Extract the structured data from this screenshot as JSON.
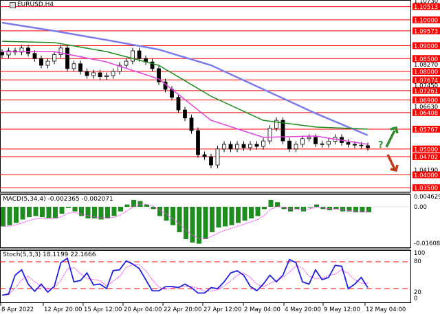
{
  "title": "EURUSD,H4",
  "colors": {
    "ma_slow": "#7b7bf0",
    "ma_mid": "#1a8a1a",
    "ma_fast": "#e040e0",
    "level": "#ff0000",
    "macd_hist": "#1e8c1e",
    "macd_signal": "#ff40ff",
    "stoch_main": "#1f1fe0",
    "stoch_signal": "#ff40ff",
    "up": "#2e8b2e",
    "down": "#c03a1a"
  },
  "chart_data": {
    "type": "candlestick",
    "symbol": "EURUSD",
    "timeframe": "H4",
    "ylim": [
      1.0337,
      1.1073
    ],
    "closes": [
      1.0864,
      1.088,
      1.0875,
      1.0891,
      1.087,
      1.085,
      1.0824,
      1.084,
      1.0865,
      1.0891,
      1.0811,
      1.083,
      1.08,
      1.0784,
      1.0795,
      1.078,
      1.0784,
      1.08,
      1.0824,
      1.084,
      1.088,
      1.085,
      1.0837,
      1.0811,
      1.076,
      1.0731,
      1.07,
      1.0651,
      1.062,
      1.0571,
      1.0478,
      1.047,
      1.0438,
      1.05,
      1.0518,
      1.05,
      1.0518,
      1.0505,
      1.0518,
      1.051,
      1.0531,
      1.058,
      1.0611,
      1.0531,
      1.05,
      1.0518,
      1.054,
      1.0545,
      1.052,
      1.0518,
      1.053,
      1.0545,
      1.0525,
      1.0518,
      1.0515,
      1.0513,
      1.0505
    ],
    "ma_index": [
      0,
      8,
      16,
      24,
      32,
      40,
      48,
      56
    ],
    "ma_slow": [
      1.0989,
      1.0957,
      1.0922,
      1.0885,
      1.0824,
      1.0731,
      1.0638,
      1.0553
    ],
    "ma_mid": [
      1.0917,
      1.0912,
      1.0877,
      1.0824,
      1.0704,
      1.0611,
      1.0585,
      1.0577
    ],
    "ma_fast": [
      1.0877,
      1.0877,
      1.0837,
      1.0771,
      1.0611,
      1.0545,
      1.055,
      1.0518
    ],
    "levels": [
      {
        "price": 1.10513,
        "label": "1.10513"
      },
      {
        "price": 1.1,
        "label": "1.10000"
      },
      {
        "price": 1.09573,
        "label": "1.09573"
      },
      {
        "price": 1.09,
        "label": "1.09000"
      },
      {
        "price": 1.085,
        "label": "1.08500"
      },
      {
        "price": 1.08,
        "label": "1.08000"
      },
      {
        "price": 1.07674,
        "label": "1.07674"
      },
      {
        "price": 1.07261,
        "label": "1.07261"
      },
      {
        "price": 1.069,
        "label": "1.06900"
      },
      {
        "price": 1.06408,
        "label": "1.06408"
      },
      {
        "price": 1.05767,
        "label": "1.05767"
      },
      {
        "price": 1.05,
        "label": "1.05000"
      },
      {
        "price": 1.04702,
        "label": "1.04702"
      },
      {
        "price": 1.04,
        "label": "1.04000"
      },
      {
        "price": 1.035,
        "label": "1.03500"
      }
    ],
    "price_ticks": [
      {
        "price": 1.1073,
        "label": "1.10730"
      },
      {
        "price": 1.0827,
        "label": "1.08270"
      },
      {
        "price": 1.0745,
        "label": "1.07450"
      },
      {
        "price": 1.0663,
        "label": "1.06630"
      },
      {
        "price": 1.0419,
        "label": "1.04190"
      }
    ],
    "x_labels": [
      "8 Apr 2022",
      "12 Apr 20:00",
      "15 Apr 12:00",
      "20 Apr 04:00",
      "22 Apr 20:00",
      "27 Apr 12:00",
      "2 May 04:00",
      "4 May 20:00",
      "9 May 12:00",
      "12 May 04:00"
    ],
    "macd": {
      "label": "MACD(5,34,4) -0.002365 -0.002071",
      "ylim": [
        -0.016088,
        0.004629
      ],
      "ticks": [
        "0.004629",
        "0.00",
        "-0.016088"
      ],
      "hist": [
        -0.0085,
        -0.008,
        -0.007,
        -0.0055,
        -0.0045,
        -0.004,
        -0.0045,
        -0.005,
        -0.005,
        -0.003,
        -0.0005,
        -0.002,
        -0.004,
        -0.005,
        -0.005,
        -0.0055,
        -0.005,
        -0.004,
        -0.002,
        0.001,
        0.003,
        0.0025,
        0.001,
        -0.001,
        -0.004,
        -0.006,
        -0.008,
        -0.011,
        -0.014,
        -0.0155,
        -0.016,
        -0.014,
        -0.011,
        -0.009,
        -0.0085,
        -0.008,
        -0.007,
        -0.006,
        -0.005,
        -0.004,
        -0.001,
        0.003,
        0.002,
        -0.001,
        -0.002,
        -0.001,
        -0.002,
        0.0,
        0.001,
        -0.001,
        -0.0015,
        -0.001,
        -0.002,
        -0.002,
        -0.0024,
        -0.0024,
        -0.0024
      ]
    },
    "stoch": {
      "label": "Stoch(5,3,3) 18.1199 22.1666",
      "ylim": [
        0,
        100
      ],
      "ticks": [
        "100",
        "80",
        "20",
        "0"
      ],
      "levels": [
        80,
        20
      ],
      "main": [
        5,
        8,
        50,
        62,
        30,
        14,
        30,
        12,
        25,
        78,
        88,
        35,
        38,
        55,
        28,
        30,
        20,
        60,
        62,
        82,
        75,
        65,
        40,
        15,
        15,
        24,
        25,
        22,
        30,
        22,
        10,
        10,
        22,
        20,
        35,
        55,
        60,
        50,
        25,
        15,
        30,
        50,
        35,
        50,
        85,
        78,
        35,
        30,
        62,
        40,
        45,
        72,
        70,
        20,
        30,
        45,
        22
      ]
    }
  }
}
